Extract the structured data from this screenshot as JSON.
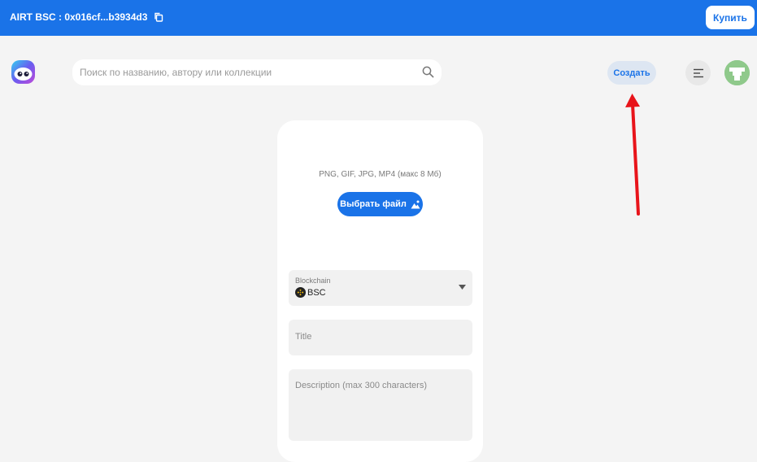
{
  "topbar": {
    "wallet_label": "AIRT BSC : 0x016cf...b3934d3",
    "buy_label": "Купить"
  },
  "header": {
    "search_placeholder": "Поиск по названию, автору или коллекции",
    "create_label": "Создать"
  },
  "upload": {
    "formats": "PNG, GIF, JPG, MP4 (макс 8 Мб)",
    "choose_label": "Выбрать файл"
  },
  "form": {
    "blockchain_label": "Blockchain",
    "blockchain_value": "BSC",
    "title_placeholder": "Title",
    "description_placeholder": "Description (max 300 characters)"
  },
  "colors": {
    "accent": "#1a73e8",
    "arrow": "#e8141a"
  },
  "icons": [
    "copy-icon",
    "logo-icon",
    "search-icon",
    "menu-icon",
    "avatar",
    "image-icon",
    "bnb-icon",
    "chevron-down-icon",
    "arrow"
  ]
}
